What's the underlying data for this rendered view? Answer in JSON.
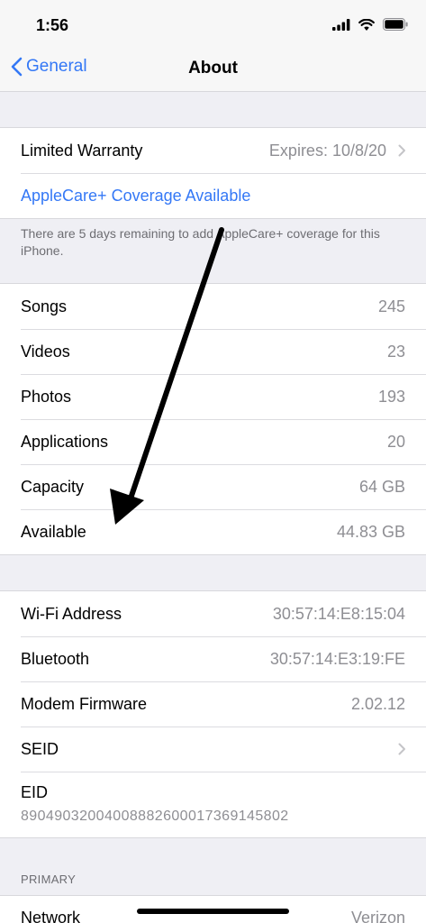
{
  "status_bar": {
    "time": "1:56",
    "icons": [
      "signal-icon",
      "wifi-icon",
      "battery-icon"
    ]
  },
  "nav": {
    "back_label": "General",
    "title": "About"
  },
  "warranty": {
    "limited_warranty_label": "Limited Warranty",
    "limited_warranty_value": "Expires: 10/8/20",
    "applecare_link": "AppleCare+ Coverage Available",
    "footer": "There are 5 days remaining to add AppleCare+ coverage for this iPhone."
  },
  "stats": [
    {
      "label": "Songs",
      "value": "245"
    },
    {
      "label": "Videos",
      "value": "23"
    },
    {
      "label": "Photos",
      "value": "193"
    },
    {
      "label": "Applications",
      "value": "20"
    },
    {
      "label": "Capacity",
      "value": "64 GB"
    },
    {
      "label": "Available",
      "value": "44.83 GB"
    }
  ],
  "network": {
    "wifi_label": "Wi-Fi Address",
    "wifi_value": "30:57:14:E8:15:04",
    "bluetooth_label": "Bluetooth",
    "bluetooth_value": "30:57:14:E3:19:FE",
    "modem_label": "Modem Firmware",
    "modem_value": "2.02.12",
    "seid_label": "SEID",
    "eid_label": "EID",
    "eid_value": "89049032004008882600017369145802"
  },
  "primary": {
    "header": "PRIMARY",
    "network_label": "Network",
    "network_value": "Verizon"
  },
  "colors": {
    "accent": "#3478f6",
    "background": "#efeff4",
    "secondary_text": "#8e8e93"
  }
}
